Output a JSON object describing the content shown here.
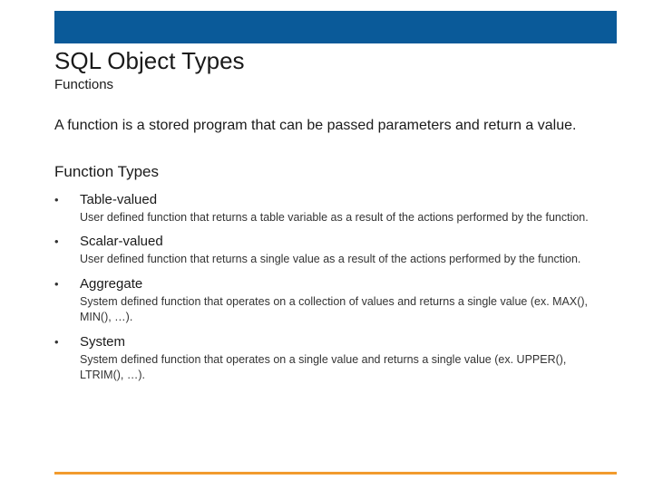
{
  "header": {
    "title": "SQL Object Types",
    "subtitle": "Functions"
  },
  "intro": "A function is a stored program that can be passed parameters and return a value.",
  "section_heading": "Function Types",
  "items": [
    {
      "title": "Table-valued",
      "desc": "User defined function that returns a table variable as a result of the actions performed by the function."
    },
    {
      "title": "Scalar-valued",
      "desc": "User defined function that returns a single value as a result of the actions performed by the function."
    },
    {
      "title": "Aggregate",
      "desc": "System defined function that operates on a collection of values and returns a single value (ex. MAX(), MIN(), …)."
    },
    {
      "title": "System",
      "desc": "System defined function that operates on a single value and returns a single value (ex. UPPER(), LTRIM(), …)."
    }
  ]
}
